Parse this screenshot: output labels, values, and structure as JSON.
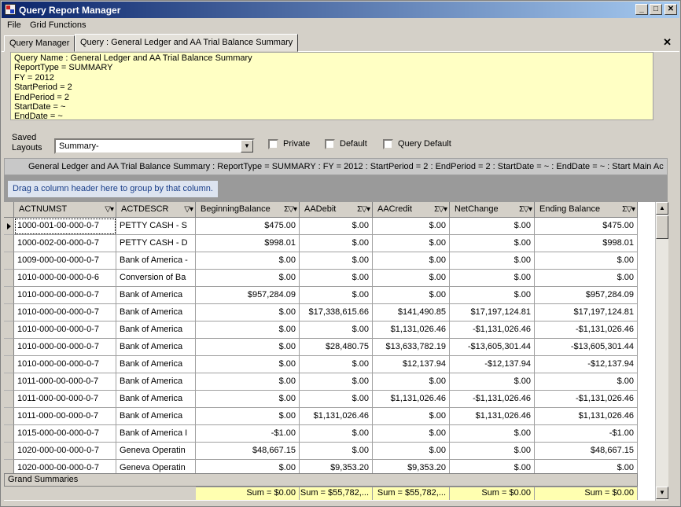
{
  "window": {
    "title": "Query Report Manager",
    "controls": {
      "minimize": "_",
      "maximize": "□",
      "close": "✕"
    }
  },
  "menu": [
    "File",
    "Grid Functions"
  ],
  "tabs": [
    {
      "label": "Query Manager",
      "active": false
    },
    {
      "label": "Query : General Ledger and AA Trial Balance Summary",
      "active": true
    }
  ],
  "tab_close": "✕",
  "query_info": [
    "Query Name : General Ledger and AA Trial Balance Summary",
    "ReportType = SUMMARY",
    "FY = 2012",
    "StartPeriod = 2",
    "EndPeriod = 2",
    "StartDate = ~",
    "EndDate = ~"
  ],
  "layouts": {
    "label_line1": "Saved",
    "label_line2": "Layouts",
    "selected": "Summary-",
    "checkboxes": [
      {
        "label": "Private",
        "checked": false
      },
      {
        "label": "Default",
        "checked": false
      },
      {
        "label": "Query Default",
        "checked": false
      }
    ]
  },
  "summary_bar": "General Ledger and AA Trial Balance Summary : ReportType = SUMMARY : FY = 2012 : StartPeriod = 2 : EndPeriod = 2 : StartDate = ~ : EndDate = ~ : Start Main Ac",
  "groupby_hint": "Drag a column header here to group by that column.",
  "columns": [
    {
      "label": "ACTNUMST",
      "icons": "▽▾"
    },
    {
      "label": "ACTDESCR",
      "icons": "▽▾"
    },
    {
      "label": "BeginningBalance",
      "icons": "Σ▽▾"
    },
    {
      "label": "AADebit",
      "icons": "Σ▽▾"
    },
    {
      "label": "AACredit",
      "icons": "Σ▽▾"
    },
    {
      "label": "NetChange",
      "icons": "Σ▽▾"
    },
    {
      "label": "Ending Balance",
      "icons": "Σ▽▾"
    }
  ],
  "rows": [
    [
      "1000-001-00-000-0-7",
      "PETTY CASH - S",
      "$475.00",
      "$.00",
      "$.00",
      "$.00",
      "$475.00"
    ],
    [
      "1000-002-00-000-0-7",
      "PETTY CASH - D",
      "$998.01",
      "$.00",
      "$.00",
      "$.00",
      "$998.01"
    ],
    [
      "1009-000-00-000-0-7",
      "Bank of America -",
      "$.00",
      "$.00",
      "$.00",
      "$.00",
      "$.00"
    ],
    [
      "1010-000-00-000-0-6",
      "Conversion of Ba",
      "$.00",
      "$.00",
      "$.00",
      "$.00",
      "$.00"
    ],
    [
      "1010-000-00-000-0-7",
      "Bank of America",
      "$957,284.09",
      "$.00",
      "$.00",
      "$.00",
      "$957,284.09"
    ],
    [
      "1010-000-00-000-0-7",
      "Bank of America",
      "$.00",
      "$17,338,615.66",
      "$141,490.85",
      "$17,197,124.81",
      "$17,197,124.81"
    ],
    [
      "1010-000-00-000-0-7",
      "Bank of America",
      "$.00",
      "$.00",
      "$1,131,026.46",
      "-$1,131,026.46",
      "-$1,131,026.46"
    ],
    [
      "1010-000-00-000-0-7",
      "Bank of America",
      "$.00",
      "$28,480.75",
      "$13,633,782.19",
      "-$13,605,301.44",
      "-$13,605,301.44"
    ],
    [
      "1010-000-00-000-0-7",
      "Bank of America",
      "$.00",
      "$.00",
      "$12,137.94",
      "-$12,137.94",
      "-$12,137.94"
    ],
    [
      "1011-000-00-000-0-7",
      "Bank of America",
      "$.00",
      "$.00",
      "$.00",
      "$.00",
      "$.00"
    ],
    [
      "1011-000-00-000-0-7",
      "Bank of America",
      "$.00",
      "$.00",
      "$1,131,026.46",
      "-$1,131,026.46",
      "-$1,131,026.46"
    ],
    [
      "1011-000-00-000-0-7",
      "Bank of America",
      "$.00",
      "$1,131,026.46",
      "$.00",
      "$1,131,026.46",
      "$1,131,026.46"
    ],
    [
      "1015-000-00-000-0-7",
      "Bank of America I",
      "-$1.00",
      "$.00",
      "$.00",
      "$.00",
      "-$1.00"
    ],
    [
      "1020-000-00-000-0-7",
      "Geneva Operatin",
      "$48,667.15",
      "$.00",
      "$.00",
      "$.00",
      "$48,667.15"
    ],
    [
      "1020-000-00-000-0-7",
      "Geneva Operatin",
      "$.00",
      "$9,353.20",
      "$9,353.20",
      "$.00",
      "$.00"
    ]
  ],
  "grand_summaries_label": "Grand Summaries",
  "sums": [
    "Sum = $0.00",
    "Sum = $55,782,...",
    "Sum = $55,782,...",
    "Sum = $0.00",
    "Sum = $0.00"
  ],
  "scroll": {
    "up": "▲",
    "down": "▼"
  },
  "colors": {
    "query_bg": "#ffffc4",
    "sum_bg": "#ffffb0",
    "hint_text": "#1a3f8a"
  }
}
